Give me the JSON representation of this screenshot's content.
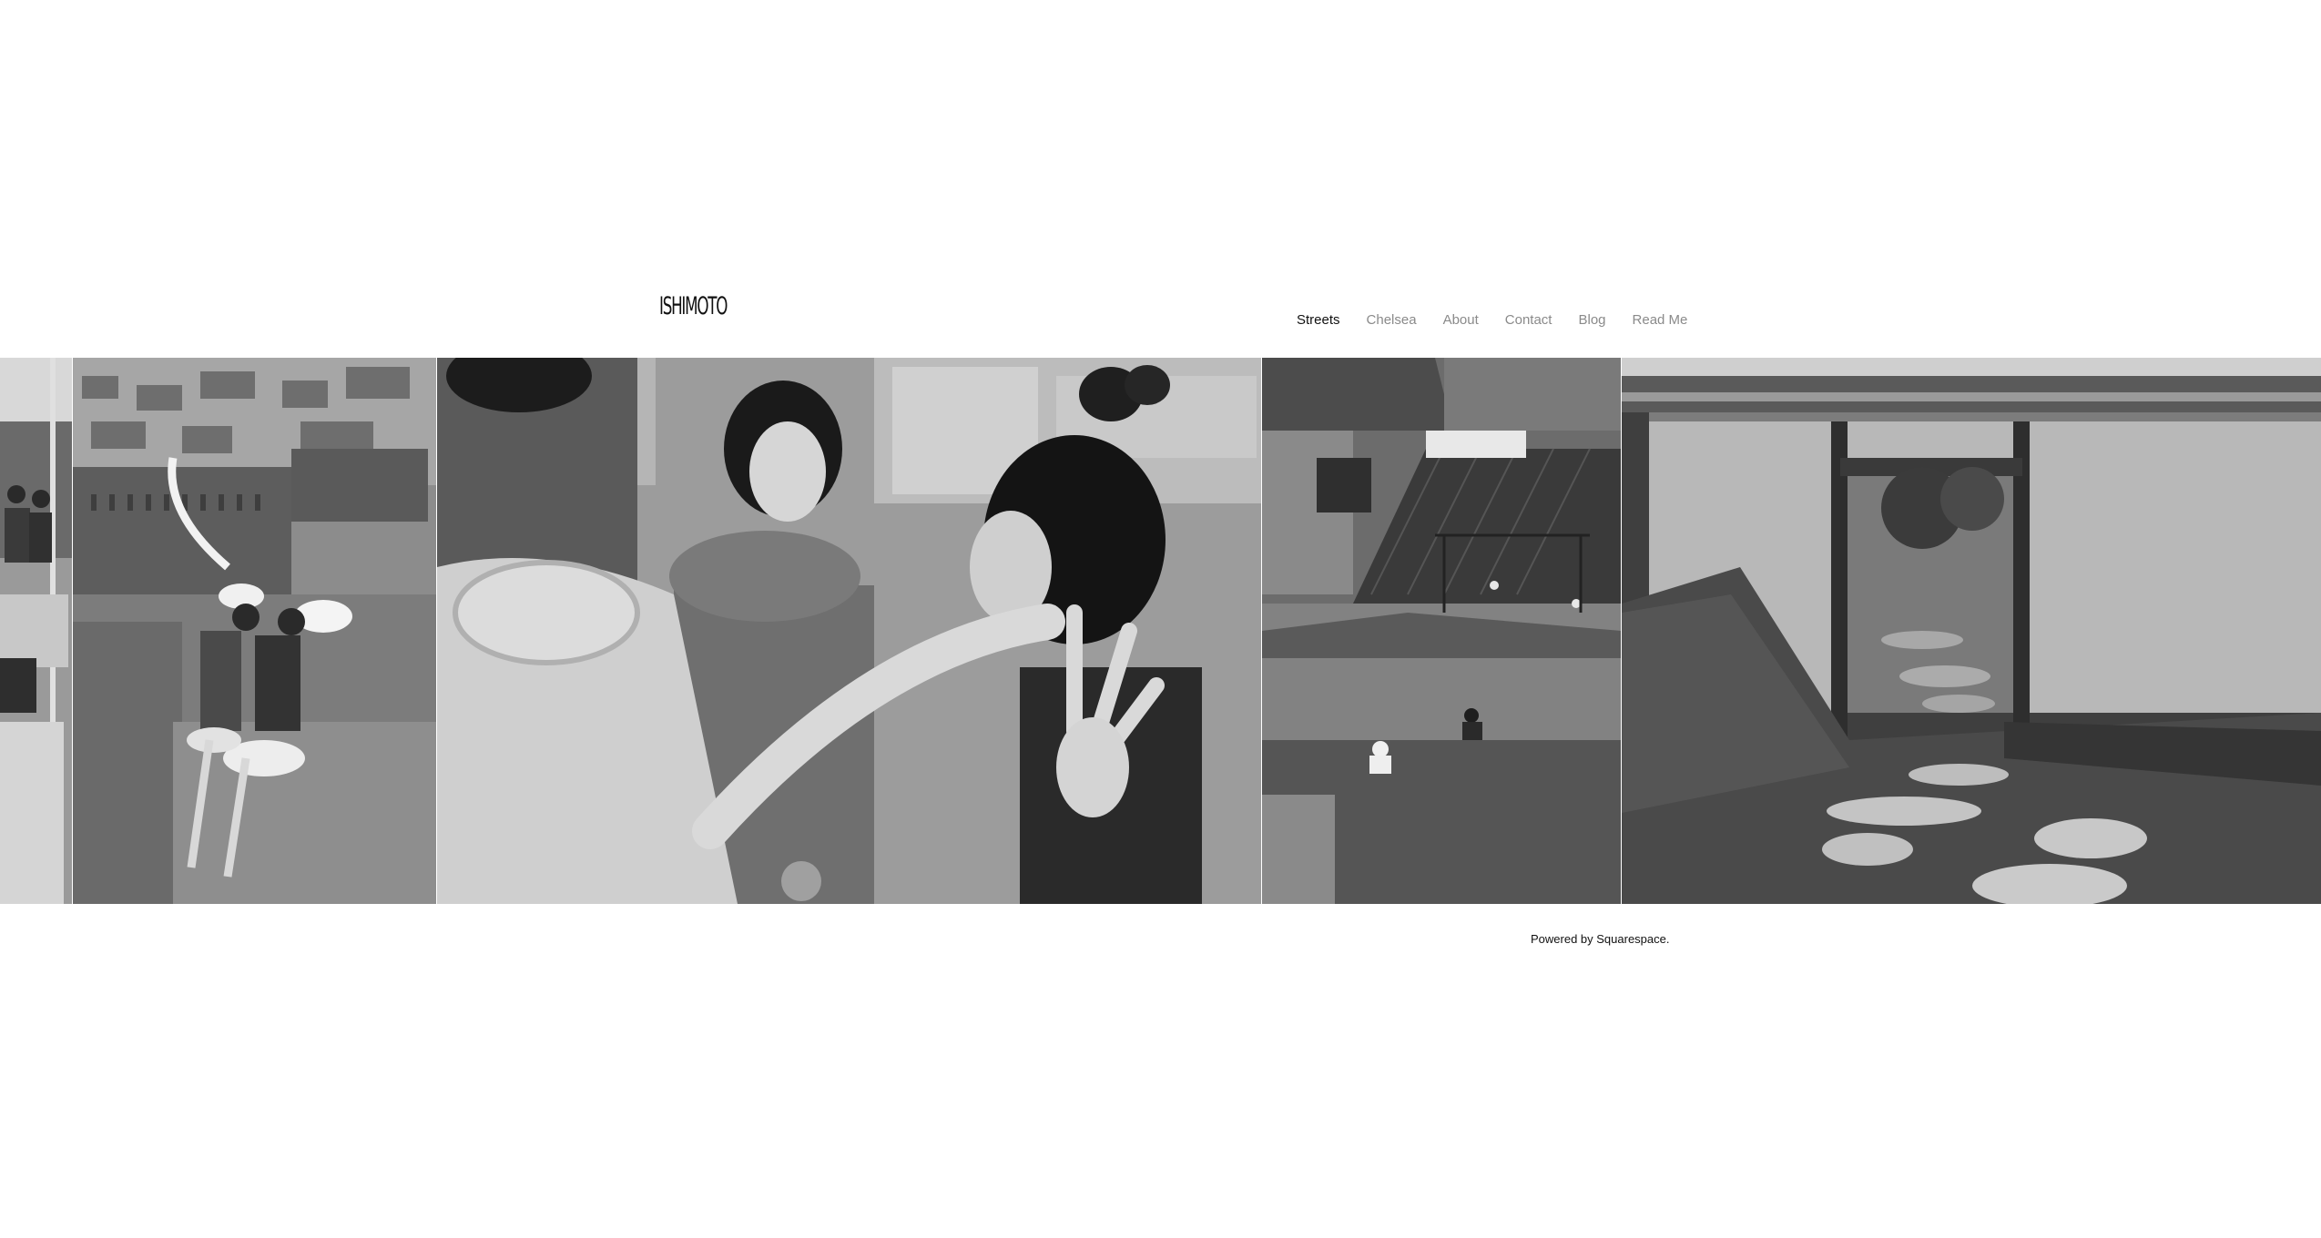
{
  "site": {
    "logo_text": "ISHIMOTO"
  },
  "nav": {
    "items": [
      {
        "label": "Streets",
        "active": true
      },
      {
        "label": "Chelsea",
        "active": false
      },
      {
        "label": "About",
        "active": false
      },
      {
        "label": "Contact",
        "active": false
      },
      {
        "label": "Blog",
        "active": false
      },
      {
        "label": "Read Me",
        "active": false
      }
    ]
  },
  "gallery": {
    "photos": [
      {
        "subject": "office-interior-partial"
      },
      {
        "subject": "girls-on-rooftop"
      },
      {
        "subject": "women-laughing"
      },
      {
        "subject": "rooftops-aerial"
      },
      {
        "subject": "japanese-garden-gate"
      }
    ]
  },
  "footer": {
    "powered_by": "Powered by Squarespace."
  },
  "colors": {
    "background": "#ffffff",
    "nav_active": "#111111",
    "nav_inactive": "#8a8a8a"
  }
}
